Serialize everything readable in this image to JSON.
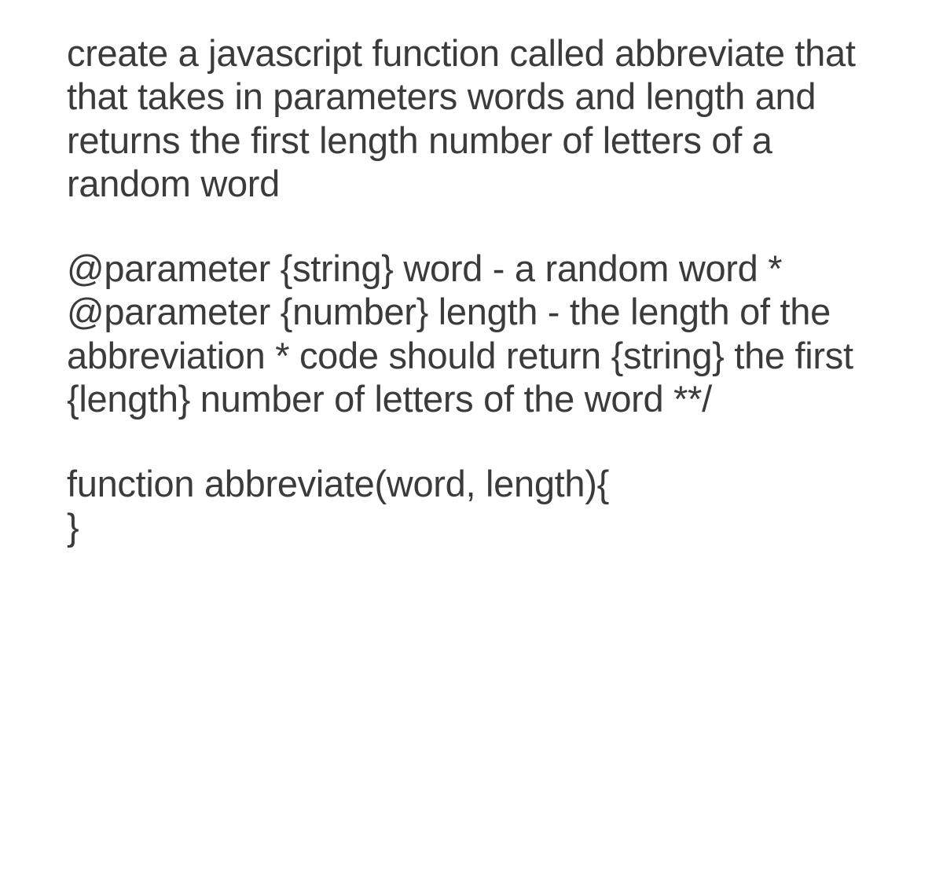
{
  "para1": "create a javascript function called abbreviate that that takes in parameters words and length and returns the first length number of letters of a random word",
  "doc": {
    "l1": "@parameter {string} word - a random word",
    "l2": "* @parameter {number} length - the length of the abbreviation",
    "l3": "* code should return {string} the first {length} number of letters of the word",
    "l4": "**/"
  },
  "code": {
    "open": "function abbreviate(word, length){",
    "close": "}"
  }
}
